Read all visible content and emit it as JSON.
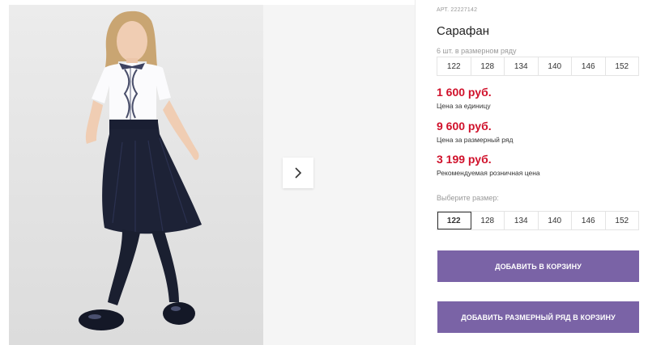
{
  "product": {
    "article": "АРТ. 22227142",
    "title": "Сарафан"
  },
  "pack": {
    "label": "6 шт. в размерном ряду",
    "sizes": [
      "122",
      "128",
      "134",
      "140",
      "146",
      "152"
    ]
  },
  "prices": {
    "unit_price": "1 600 руб.",
    "unit_caption": "Цена за единицу",
    "pack_price": "9 600 руб.",
    "pack_caption": "Цена за размерный ряд",
    "retail_price": "3 199 руб.",
    "retail_caption": "Рекомендуемая розничная цена"
  },
  "size_select": {
    "label": "Выберите размер:",
    "options": [
      "122",
      "128",
      "134",
      "140",
      "146",
      "152"
    ],
    "selected": "122"
  },
  "buttons": {
    "add_to_cart": "ДОБАВИТЬ В КОРЗИНУ",
    "add_pack_to_cart": "ДОБАВИТЬ РАЗМЕРНЫЙ РЯД В КОРЗИНУ"
  },
  "gallery": {
    "next_icon": "chevron-right-icon"
  },
  "colors": {
    "accent": "#7a63a6",
    "price": "#d0112b"
  }
}
